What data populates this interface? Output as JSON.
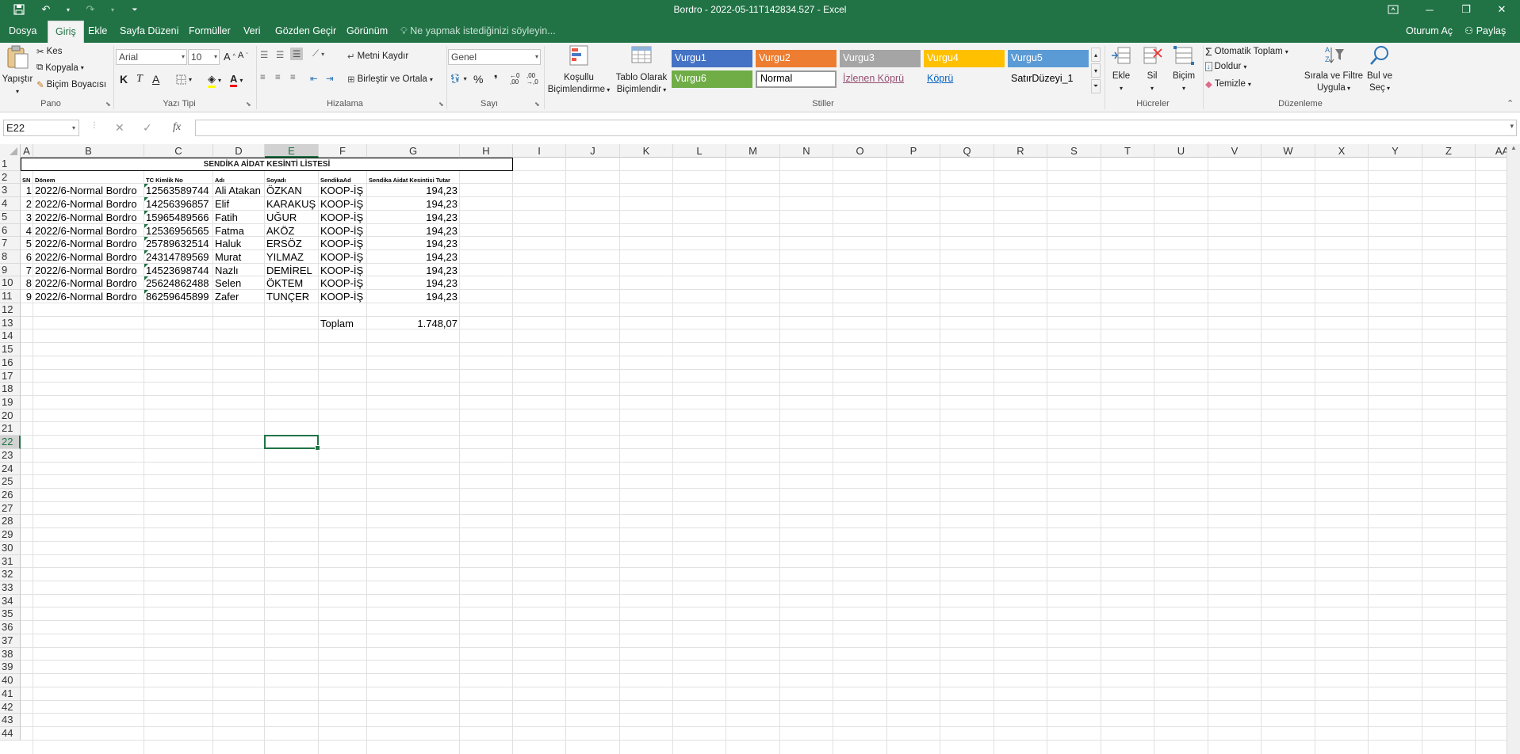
{
  "window": {
    "title": "Bordro - 2022-05-11T142834.527 - Excel",
    "signin": "Oturum Aç",
    "share": "Paylaş",
    "accent": "#217346"
  },
  "tabs": [
    "Dosya",
    "Giriş",
    "Ekle",
    "Sayfa Düzeni",
    "Formüller",
    "Veri",
    "Gözden Geçir",
    "Görünüm"
  ],
  "tell_me": "Ne yapmak istediğinizi söyleyin...",
  "ribbon": {
    "clipboard": {
      "paste": "Yapıştır",
      "cut": "Kes",
      "copy": "Kopyala",
      "painter": "Biçim Boyacısı",
      "label": "Pano"
    },
    "font": {
      "name": "Arial",
      "size": "10",
      "bold": "K",
      "italic": "T",
      "underline": "A",
      "label": "Yazı Tipi"
    },
    "alignment": {
      "wrap": "Metni Kaydır",
      "merge": "Birleştir ve Ortala",
      "label": "Hizalama"
    },
    "number": {
      "format": "Genel",
      "percent": "%",
      "comma": "❜",
      "label": "Sayı"
    },
    "styles": {
      "conditional_1": "Koşullu",
      "conditional_2": "Biçimlendirme",
      "table_1": "Tablo Olarak",
      "table_2": "Biçimlendir",
      "items": [
        "Vurgu1",
        "Vurgu2",
        "Vurgu3",
        "Vurgu4",
        "Vurgu5",
        "Vurgu6",
        "Normal",
        "İzlenen Köprü",
        "Köprü",
        "SatırDüzeyi_1"
      ],
      "label": "Stiller"
    },
    "cells": {
      "insert": "Ekle",
      "delete": "Sil",
      "format": "Biçim",
      "label": "Hücreler"
    },
    "editing": {
      "autosum": "Otomatik Toplam",
      "fill": "Doldur",
      "clear": "Temizle",
      "sort_1": "Sırala ve Filtre",
      "sort_2": "Uygula",
      "find_1": "Bul ve",
      "find_2": "Seç",
      "label": "Düzenleme"
    }
  },
  "formula_bar": {
    "name_box": "E22",
    "fx": "fx",
    "content": ""
  },
  "columns": [
    "A",
    "B",
    "C",
    "D",
    "E",
    "F",
    "G",
    "H",
    "I",
    "J",
    "K",
    "L",
    "M",
    "N",
    "O",
    "P",
    "Q",
    "R",
    "S",
    "T",
    "U",
    "V",
    "W",
    "X",
    "Y",
    "Z",
    "AA"
  ],
  "rows": [
    "1",
    "2",
    "3",
    "4",
    "5",
    "6",
    "7",
    "8",
    "9",
    "10",
    "11",
    "12",
    "13",
    "14",
    "15",
    "16",
    "17",
    "18",
    "19",
    "20",
    "21",
    "22",
    "23",
    "24",
    "25",
    "26",
    "27",
    "28",
    "29",
    "30",
    "31",
    "32",
    "33",
    "34",
    "35",
    "36",
    "37",
    "38",
    "39",
    "40",
    "41",
    "42",
    "43",
    "44"
  ],
  "sheet": {
    "title": "SENDİKA AİDAT KESİNTİ LİSTESİ",
    "headers": [
      "SN",
      "Dönem",
      "TC Kimlik No",
      "Adı",
      "Soyadı",
      "SendikaAd",
      "Sendika Aidat Kesintisi Tutar"
    ],
    "records": [
      [
        "1",
        "2022/6-Normal Bordro",
        "12563589744",
        "Ali Atakan",
        "ÖZKAN",
        "KOOP-İŞ",
        "194,23"
      ],
      [
        "2",
        "2022/6-Normal Bordro",
        "14256396857",
        "Elif",
        "KARAKUŞ",
        "KOOP-İŞ",
        "194,23"
      ],
      [
        "3",
        "2022/6-Normal Bordro",
        "15965489566",
        "Fatih",
        "UĞUR",
        "KOOP-İŞ",
        "194,23"
      ],
      [
        "4",
        "2022/6-Normal Bordro",
        "12536956565",
        "Fatma",
        "AKÖZ",
        "KOOP-İŞ",
        "194,23"
      ],
      [
        "5",
        "2022/6-Normal Bordro",
        "25789632514",
        "Haluk",
        "ERSÖZ",
        "KOOP-İŞ",
        "194,23"
      ],
      [
        "6",
        "2022/6-Normal Bordro",
        "24314789569",
        "Murat",
        "YILMAZ",
        "KOOP-İŞ",
        "194,23"
      ],
      [
        "7",
        "2022/6-Normal Bordro",
        "14523698744",
        "Nazlı",
        "DEMİREL",
        "KOOP-İŞ",
        "194,23"
      ],
      [
        "8",
        "2022/6-Normal Bordro",
        "25624862488",
        "Selen",
        "ÖKTEM",
        "KOOP-İŞ",
        "194,23"
      ],
      [
        "9",
        "2022/6-Normal Bordro",
        "86259645899",
        "Zafer",
        "TUNÇER",
        "KOOP-İŞ",
        "194,23"
      ]
    ],
    "total_label": "Toplam",
    "total_value": "1.748,07"
  },
  "style_colors": {
    "vurgu1": "#4472c4",
    "vurgu2": "#ed7d31",
    "vurgu3": "#a5a5a5",
    "vurgu4": "#ffc000",
    "vurgu5": "#5b9bd5",
    "vurgu6": "#70ad47"
  }
}
